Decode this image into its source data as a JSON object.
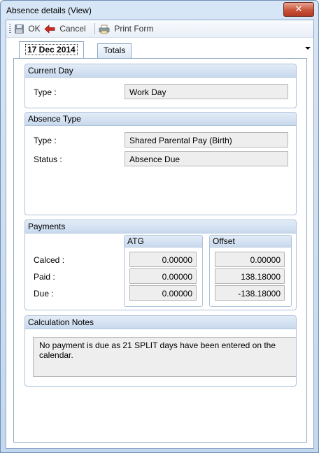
{
  "window": {
    "title": "Absence details (View)",
    "close_glyph": "✕"
  },
  "toolbar": {
    "ok_label": "OK",
    "cancel_label": "Cancel",
    "print_label": "Print Form"
  },
  "tabs": [
    {
      "label": "17 Dec 2014",
      "active": true
    },
    {
      "label": "Totals",
      "active": false
    }
  ],
  "current_day": {
    "header": "Current Day",
    "type_label": "Type :",
    "type_value": "Work Day"
  },
  "absence_type": {
    "header": "Absence Type",
    "type_label": "Type :",
    "type_value": "Shared Parental Pay (Birth)",
    "status_label": "Status :",
    "status_value": "Absence Due"
  },
  "payments": {
    "header": "Payments",
    "atg_header": "ATG",
    "offset_header": "Offset",
    "rows": [
      {
        "label": "Calced :",
        "atg": "0.00000",
        "offset": "0.00000"
      },
      {
        "label": "Paid :",
        "atg": "0.00000",
        "offset": "138.18000"
      },
      {
        "label": "Due :",
        "atg": "0.00000",
        "offset": "-138.18000"
      }
    ]
  },
  "calculation_notes": {
    "header": "Calculation Notes",
    "text": "No payment is due as 21 SPLIT days have been entered on the calendar."
  },
  "colors": {
    "header_gradient_top": "#e3ecf7",
    "header_gradient_bottom": "#c9daee",
    "field_background": "#eeeeee",
    "close_button": "#c9553b"
  }
}
